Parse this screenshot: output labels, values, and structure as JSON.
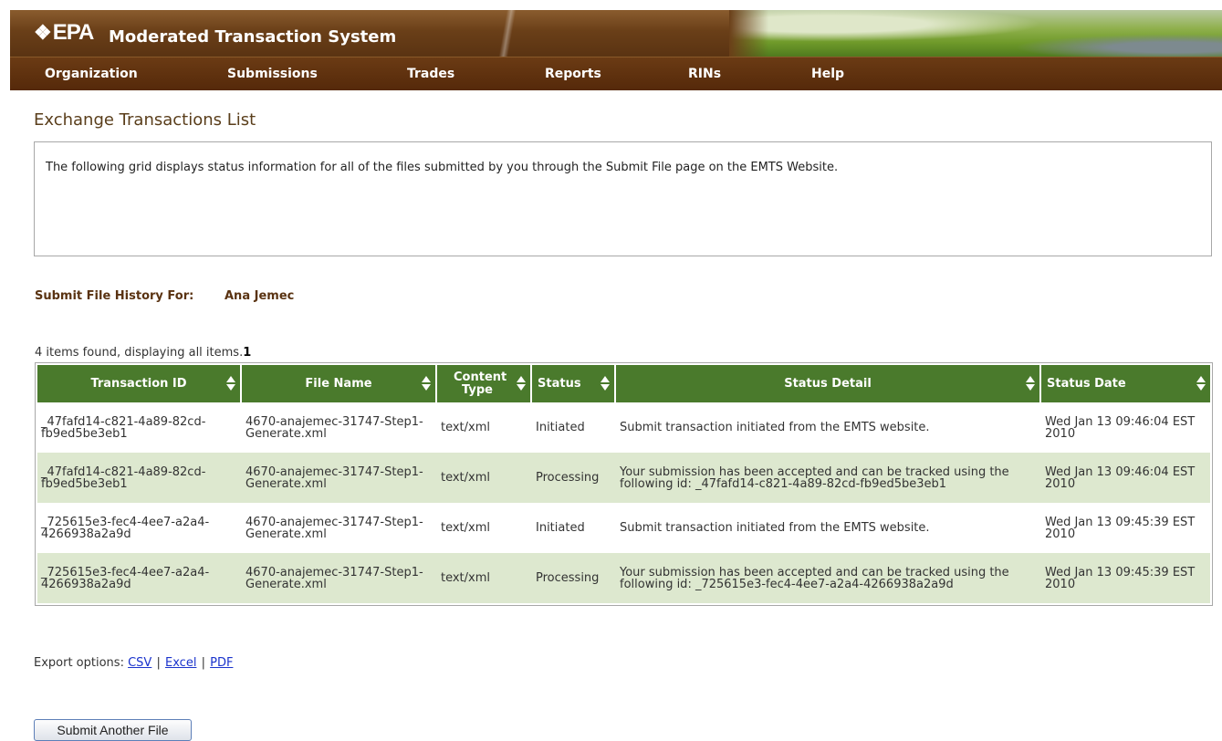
{
  "brand": {
    "logo": "EPA",
    "app_title": "Moderated Transaction System"
  },
  "nav": [
    "Organization",
    "Submissions",
    "Trades",
    "Reports",
    "RINs",
    "Help"
  ],
  "page_title": "Exchange Transactions List",
  "info_text": "The following grid displays status information for all of the files submitted by you through the Submit File page on the EMTS Website.",
  "history": {
    "label": "Submit File History For:",
    "user": "Ana Jemec"
  },
  "count_text": "4 items found, displaying all items.",
  "page_number": "1",
  "table": {
    "columns": [
      "Transaction ID",
      "File Name",
      "Content Type",
      "Status",
      "Status Detail",
      "Status Date"
    ],
    "rows": [
      [
        "_47fafd14-c821-4a89-82cd-fb9ed5be3eb1",
        "4670-anajemec-31747-Step1-Generate.xml",
        "text/xml",
        "Initiated",
        "Submit transaction initiated from the EMTS website.",
        "Wed Jan 13 09:46:04 EST 2010"
      ],
      [
        "_47fafd14-c821-4a89-82cd-fb9ed5be3eb1",
        "4670-anajemec-31747-Step1-Generate.xml",
        "text/xml",
        "Processing",
        "Your submission has been accepted and can be tracked using the following id: _47fafd14-c821-4a89-82cd-fb9ed5be3eb1",
        "Wed Jan 13 09:46:04 EST 2010"
      ],
      [
        "_725615e3-fec4-4ee7-a2a4-4266938a2a9d",
        "4670-anajemec-31747-Step1-Generate.xml",
        "text/xml",
        "Initiated",
        "Submit transaction initiated from the EMTS website.",
        "Wed Jan 13 09:45:39 EST 2010"
      ],
      [
        "_725615e3-fec4-4ee7-a2a4-4266938a2a9d",
        "4670-anajemec-31747-Step1-Generate.xml",
        "text/xml",
        "Processing",
        "Your submission has been accepted and can be tracked using the following id: _725615e3-fec4-4ee7-a2a4-4266938a2a9d",
        "Wed Jan 13 09:45:39 EST 2010"
      ]
    ]
  },
  "export": {
    "label": "Export options:",
    "options": [
      "CSV",
      "Excel",
      "PDF"
    ],
    "separator": "|"
  },
  "submit_button": "Submit Another File",
  "colors": {
    "nav_brown": "#5a3312",
    "header_green": "#4a7a2c",
    "alt_row": "#dde8cf",
    "link": "#1a33cc"
  },
  "icons": {
    "sort": "sort-arrows-icon",
    "seal": "epa-seal-icon"
  }
}
